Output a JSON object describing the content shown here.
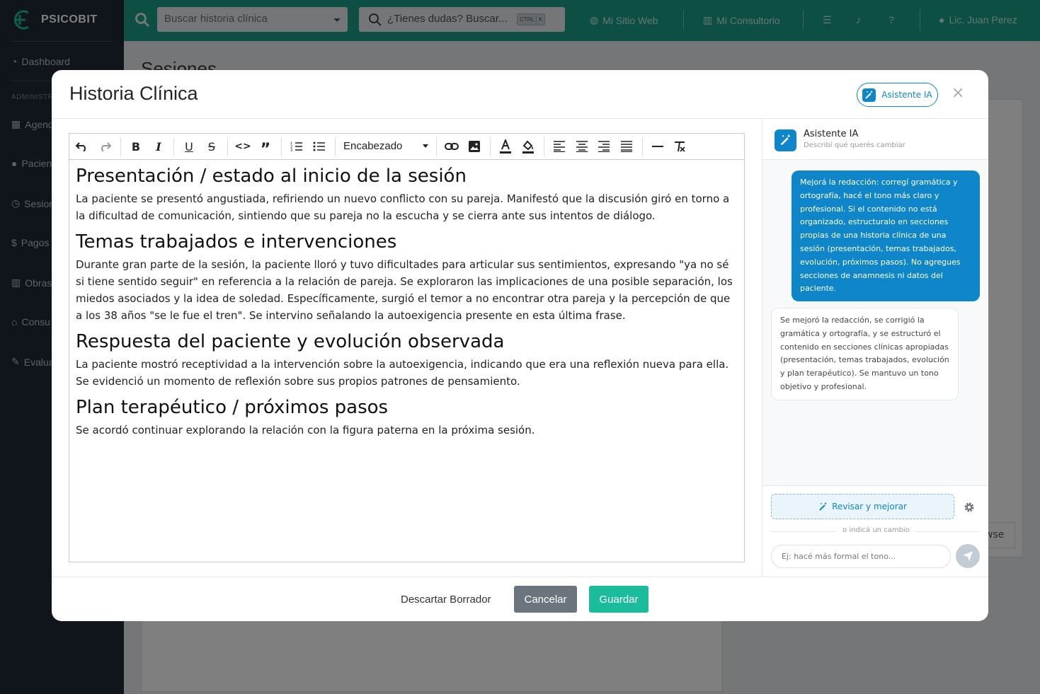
{
  "app": {
    "name": "PSICOBIT"
  },
  "sidebar": {
    "items": [
      {
        "label": "Dashboard"
      },
      {
        "label": "Agend"
      },
      {
        "label": "Pacien"
      },
      {
        "label": "Sesion"
      },
      {
        "label": "Pagos"
      },
      {
        "label": "Obras"
      },
      {
        "label": "Consu"
      },
      {
        "label": "Evalua"
      }
    ],
    "section_label": "ADMINISTR"
  },
  "topbar": {
    "search_placeholder": "Buscar historia clínica",
    "doubts_placeholder": "¿Tienes dudas? Buscar...",
    "kbd_ctrl": "CTRL",
    "kbd_k": "K",
    "links": [
      "Mi Sitio Web",
      "Mi Consultorio"
    ],
    "user": "Lic. Juan Perez"
  },
  "background": {
    "page_title": "Sesiones",
    "browse": "wse"
  },
  "modal": {
    "title": "Historia Clínica",
    "ai_button": "Asistente IA",
    "close": "×",
    "toolbar": {
      "heading_select": "Encabezado"
    },
    "document": [
      {
        "h": "Presentación / estado al inicio de la sesión",
        "p": "La paciente se presentó angustiada, refiriendo un nuevo conflicto con su pareja. Manifestó que la discusión giró en torno a la dificultad de comunicación, sintiendo que su pareja no la escucha y se cierra ante sus intentos de diálogo."
      },
      {
        "h": "Temas trabajados e intervenciones",
        "p": "Durante gran parte de la sesión, la paciente lloró y tuvo dificultades para articular sus sentimientos, expresando \"ya no sé si tiene sentido seguir\" en referencia a la relación de pareja. Se exploraron las implicaciones de una posible separación, los miedos asociados y la idea de soledad. Específicamente, surgió el temor a no encontrar otra pareja y la percepción de que a los 38 años \"se le fue el tren\". Se intervino señalando la autoexigencia presente en esta última frase."
      },
      {
        "h": "Respuesta del paciente y evolución observada",
        "p": "La paciente mostró receptividad a la intervención sobre la autoexigencia, indicando que era una reflexión nueva para ella. Se evidenció un momento de reflexión sobre sus propios patrones de pensamiento."
      },
      {
        "h": "Plan terapéutico / próximos pasos",
        "p": "Se acordó continuar explorando la relación con la figura paterna en la próxima sesión."
      }
    ],
    "assistant": {
      "title": "Asistente IA",
      "subtitle": "Describí qué querés cambiar",
      "user_message": "Mejorá la redacción: corregí gramática y ortografía, hacé el tono más claro y profesional. Si el contenido no está organizado, estructuralo en secciones propias de una historia clínica de una sesión (presentación, temas trabajados, evolución, próximos pasos). No agregues secciones de anamnesis ni datos del paciente.",
      "ai_message": "Se mejoró la redacción, se corrigió la gramática y ortografía, y se estructuró el contenido en secciones clínicas apropiadas (presentación, temas trabajados, evolución y plan terapéutico). Se mantuvo un tono objetivo y profesional.",
      "review_button": "Revisar y mejorar",
      "or_text": "o indicá un cambio",
      "input_placeholder": "Ej: hacé más formal el tono..."
    },
    "footer": {
      "discard": "Descartar Borrador",
      "cancel": "Cancelar",
      "save": "Guardar"
    }
  },
  "colors": {
    "primary": "#1aa086",
    "accent": "#0e86c9",
    "sidebar": "#1f2a37",
    "save": "#1abc9c",
    "cancel": "#6c757d"
  }
}
